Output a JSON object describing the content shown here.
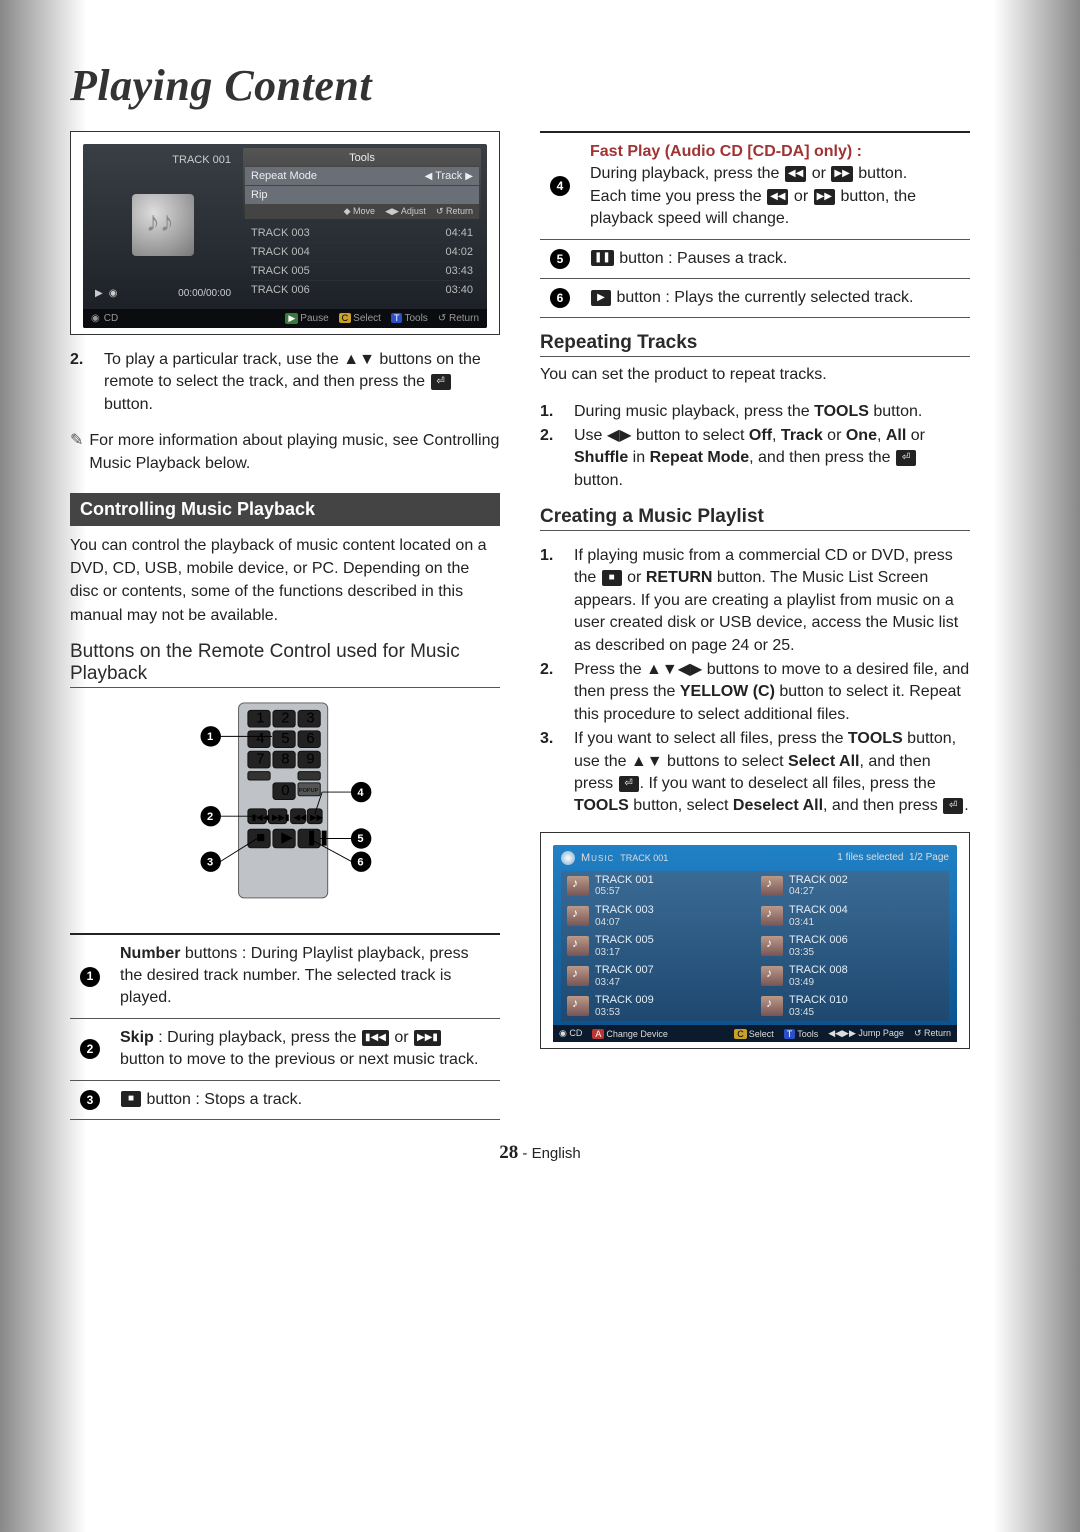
{
  "page": {
    "number": "28",
    "lang": "English"
  },
  "title": "Playing Content",
  "screen1": {
    "tools_header": "Tools",
    "repeat_mode": "Repeat Mode",
    "repeat_value": "Track",
    "rip": "Rip",
    "move": "Move",
    "adjust": "Adjust",
    "return": "Return",
    "current_track": "TRACK 001",
    "time": "00:00/00:00",
    "tracks": [
      {
        "name": "TRACK 003",
        "time": "04:41"
      },
      {
        "name": "TRACK 004",
        "time": "04:02"
      },
      {
        "name": "TRACK 005",
        "time": "03:43"
      },
      {
        "name": "TRACK 006",
        "time": "03:40"
      }
    ],
    "footer": {
      "cd": "CD",
      "pause": "Pause",
      "select": "Select",
      "tools": "Tools",
      "return": "Return"
    }
  },
  "leftcol": {
    "step2": "To play a particular track, use the ▲▼ buttons on the remote to select the track, and then press the",
    "step2_tail": "button.",
    "note": "For more information about playing music, see Controlling Music Playback below.",
    "hbar": "Controlling Music Playback",
    "intro": "You can control the playback of music content located on a DVD, CD, USB, mobile device, or PC. Depending on the disc or contents, some of the functions described in this manual may not be available.",
    "hsub": "Buttons on the Remote Control used for Music Playback",
    "legend": {
      "l1_b": "Number",
      "l1": " buttons : During Playlist playback, press the desired track number. The selected track is played.",
      "l2_b": "Skip",
      "l2": " : During playback, press the ",
      "l2_tail": " button to move to the previous or next music track.",
      "l3": " button : Stops a track."
    }
  },
  "rightcol": {
    "legend": {
      "l4_b": "Fast Play (Audio CD [CD-DA] only) :",
      "l4_a": "During playback, press the ",
      "l4_b2": " button.",
      "l4_c": "Each time you press the ",
      "l4_d": " button, the playback speed will change.",
      "l5": " button : Pauses a track.",
      "l6": " button : Plays the currently selected track."
    },
    "h_repeat": "Repeating Tracks",
    "repeat_intro": "You can set the product to repeat tracks.",
    "repeat_step1_a": "During music playback, press the ",
    "repeat_step1_b": "TOOLS",
    "repeat_step1_c": " button.",
    "repeat_step2_a": "Use ◀▶ button to select ",
    "repeat_step2_off": "Off",
    "repeat_step2_mid1": ", ",
    "repeat_step2_track": "Track",
    "repeat_step2_mid2": " or ",
    "repeat_step2_one": "One",
    "repeat_step2_mid3": ", ",
    "repeat_step2_all": "All",
    "repeat_step2_mid4": " or ",
    "repeat_step2_shuffle": "Shuffle",
    "repeat_step2_in": " in ",
    "repeat_step2_mode": "Repeat Mode",
    "repeat_step2_tail": ", and then press the ",
    "repeat_step2_end": " button.",
    "h_playlist": "Creating a Music Playlist",
    "pl_step1_a": "If playing music from a commercial CD or DVD, press the ",
    "pl_step1_b": " or ",
    "pl_step1_ret": "RETURN",
    "pl_step1_c": " button. The Music List Screen appears. If you are creating a playlist from music on a user created disk or USB device, access the Music list as described on page 24 or 25.",
    "pl_step2_a": "Press the ▲▼◀▶ buttons to move to a desired file, and then press the ",
    "pl_step2_y": "YELLOW (C)",
    "pl_step2_b": " button to select it. Repeat this procedure to select additional files.",
    "pl_step3_a": "If you want to select all files, press the ",
    "pl_step3_tools": "TOOLS",
    "pl_step3_b": " button, use the ▲▼ buttons to select ",
    "pl_step3_selall": "Select All",
    "pl_step3_c": ", and then press ",
    "pl_step3_d": ". If you want to deselect all files, press the ",
    "pl_step3_tools2": "TOOLS",
    "pl_step3_e": " button, select ",
    "pl_step3_deselall": "Deselect All",
    "pl_step3_f": ", and then press ",
    "pl_step3_g": "."
  },
  "screen2": {
    "title": "Music",
    "current": "TRACK 001",
    "status": "1 files selected",
    "page": "1/2 Page",
    "items": [
      {
        "name": "TRACK 001",
        "t": "05:57"
      },
      {
        "name": "TRACK 002",
        "t": "04:27"
      },
      {
        "name": "TRACK 003",
        "t": "04:07"
      },
      {
        "name": "TRACK 004",
        "t": "03:41"
      },
      {
        "name": "TRACK 005",
        "t": "03:17"
      },
      {
        "name": "TRACK 006",
        "t": "03:35"
      },
      {
        "name": "TRACK 007",
        "t": "03:47"
      },
      {
        "name": "TRACK 008",
        "t": "03:49"
      },
      {
        "name": "TRACK 009",
        "t": "03:53"
      },
      {
        "name": "TRACK 010",
        "t": "03:45"
      }
    ],
    "footer": {
      "cd": "CD",
      "change": "Change Device",
      "select": "Select",
      "tools": "Tools",
      "jump": "Jump Page",
      "return": "Return"
    }
  }
}
